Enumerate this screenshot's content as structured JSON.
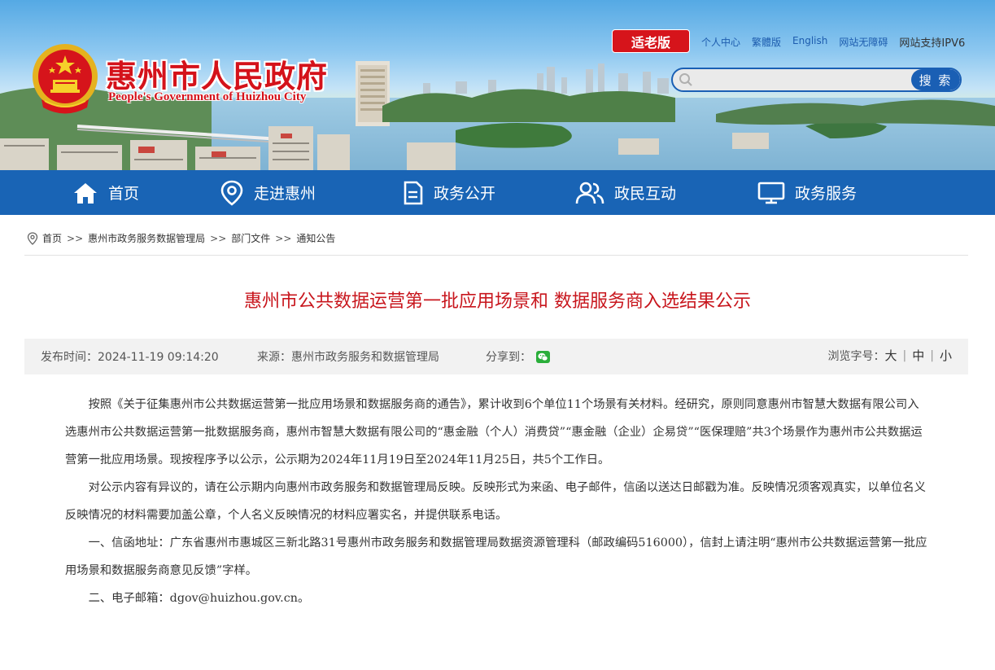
{
  "header": {
    "site_title": "惠州市人民政府",
    "site_subtitle": "People's Government of Huizhou City",
    "elder_mode_label": "适老版",
    "top_links": [
      "个人中心",
      "繁體版",
      "English",
      "网站无障碍"
    ],
    "ipv6_label": "网站支持IPV6",
    "search": {
      "placeholder": "",
      "button_label": "搜 索"
    }
  },
  "nav": {
    "items": [
      {
        "label": "首页",
        "icon": "home-icon"
      },
      {
        "label": "走进惠州",
        "icon": "location-pin-icon"
      },
      {
        "label": "政务公开",
        "icon": "document-icon"
      },
      {
        "label": "政民互动",
        "icon": "people-icon"
      },
      {
        "label": "政务服务",
        "icon": "monitor-icon"
      }
    ]
  },
  "breadcrumb": {
    "icon": "location-pin-icon",
    "items": [
      "首页",
      "惠州市政务服务数据管理局",
      "部门文件",
      "通知公告"
    ],
    "separator": ">>"
  },
  "article": {
    "title": "惠州市公共数据运营第一批应用场景和 数据服务商入选结果公示",
    "meta": {
      "publish_time": "发布时间：2024-11-19 09:14:20",
      "source": "来源：惠州市政务服务和数据管理局",
      "share_label": "分享到：",
      "share_icon": "wechat-icon",
      "font_size_label": "浏览字号：",
      "font_sizes": [
        "大",
        "中",
        "小"
      ]
    },
    "paragraphs": [
      "按照《关于征集惠州市公共数据运营第一批应用场景和数据服务商的通告》，累计收到6个单位11个场景有关材料。经研究，原则同意惠州市智慧大数据有限公司入选惠州市公共数据运营第一批数据服务商，惠州市智慧大数据有限公司的“惠金融（个人）消费贷”“惠金融（企业）企易贷”“医保理赔”共3个场景作为惠州市公共数据运营第一批应用场景。现按程序予以公示，公示期为2024年11月19日至2024年11月25日，共5个工作日。",
      "对公示内容有异议的，请在公示期内向惠州市政务服务和数据管理局反映。反映形式为来函、电子邮件，信函以送达日邮戳为准。反映情况须客观真实，以单位名义反映情况的材料需要加盖公章，个人名义反映情况的材料应署实名，并提供联系电话。",
      "一、信函地址：广东省惠州市惠城区三新北路31号惠州市政务服务和数据管理局数据资源管理科（邮政编码516000），信封上请注明“惠州市公共数据运营第一批应用场景和数据服务商意见反馈”字样。",
      "二、电子邮箱：dgov@huizhou.gov.cn。"
    ]
  },
  "colors": {
    "brand_red": "#d4121a",
    "nav_blue": "#1964b5",
    "title_red": "#c8161d",
    "link_blue": "#1d5cae"
  }
}
